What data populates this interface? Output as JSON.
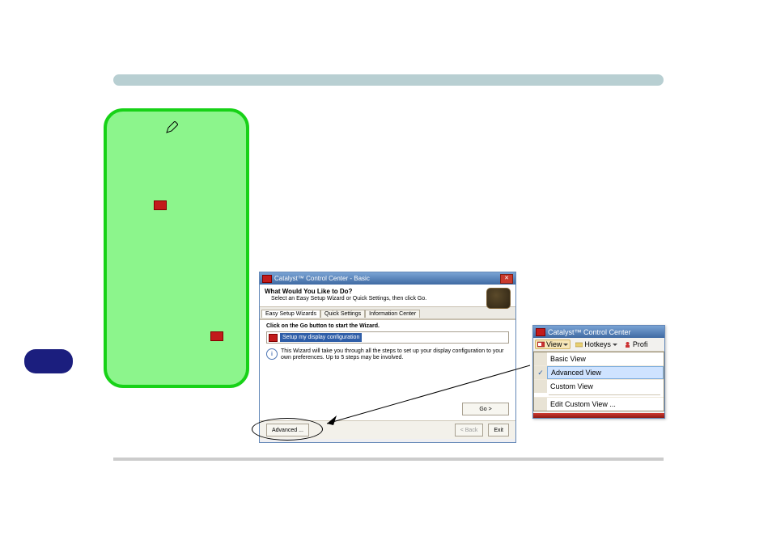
{
  "ccc": {
    "title": "Catalyst™ Control Center - Basic",
    "head_q": "What Would You Like to Do?",
    "head_sub": "Select an Easy Setup Wizard or Quick Settings, then click Go.",
    "tabs": {
      "wizards": "Easy Setup Wizards",
      "quick": "Quick Settings",
      "info": "Information Center"
    },
    "body_head": "Click on the Go button to start the Wizard.",
    "list_item": "Setup my display configuration",
    "info_text": "This Wizard will take you through all the steps to set up your display configuration to your own preferences. Up to 5 steps may be involved.",
    "go": "Go >",
    "advanced": "Advanced ...",
    "back": "< Back",
    "exit": "Exit"
  },
  "viewshot": {
    "title": "Catalyst™ Control Center",
    "toolbar": {
      "view": "View",
      "hotkeys": "Hotkeys",
      "profiles": "Profi"
    },
    "menu": {
      "basic": "Basic View",
      "advanced": "Advanced View",
      "custom": "Custom View",
      "edit": "Edit Custom View ..."
    }
  }
}
